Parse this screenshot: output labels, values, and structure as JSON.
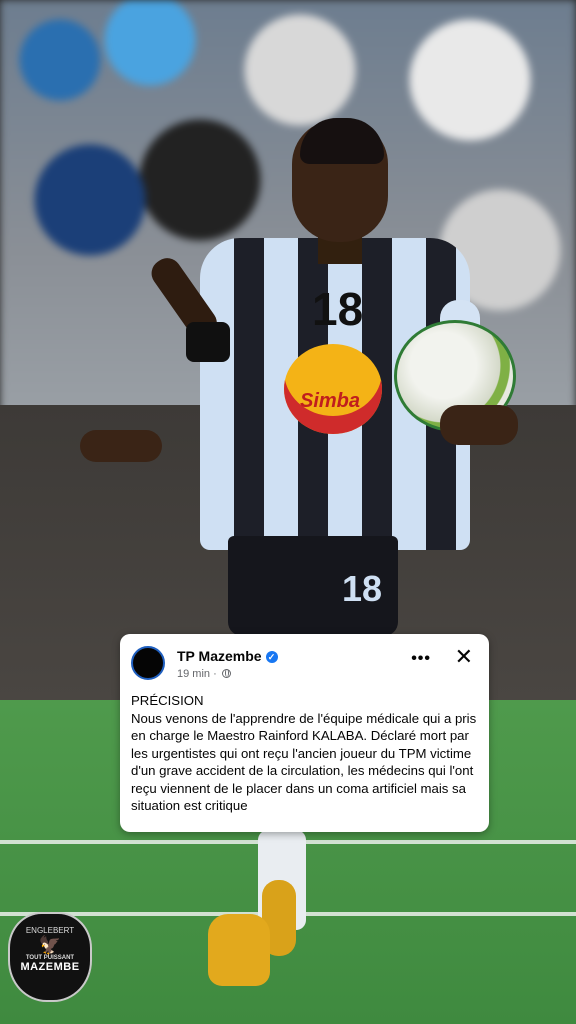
{
  "post": {
    "page_name": "TP Mazembe",
    "time": "19 min",
    "separator": "·",
    "more_label": "•••",
    "close_label": "✕",
    "text": "PRÉCISION\nNous venons de l'apprendre de l'équipe médicale qui a pris en charge le Maestro Rainford KALABA. Déclaré mort par les urgentistes qui ont reçu l'ancien joueur du TPM victime d'un grave accident de la circulation, les médecins qui l'ont reçu viennent de le placer dans un coma artificiel mais sa situation est critique"
  },
  "photo": {
    "shirt_number": "18",
    "shorts_number": "18",
    "sponsor": "Simba"
  },
  "crest": {
    "top_text": "ENGLEBERT",
    "motto": "TOUT PUISSANT",
    "name": "MAZEMBE"
  },
  "icons": {
    "verified": "verified-badge-icon",
    "audience": "globe-icon",
    "more": "more-options-icon",
    "close": "close-icon"
  },
  "colors": {
    "facebook_blue": "#1877f2",
    "meta_gray": "#65676b",
    "card_bg": "#ffffff",
    "text": "#050505"
  }
}
